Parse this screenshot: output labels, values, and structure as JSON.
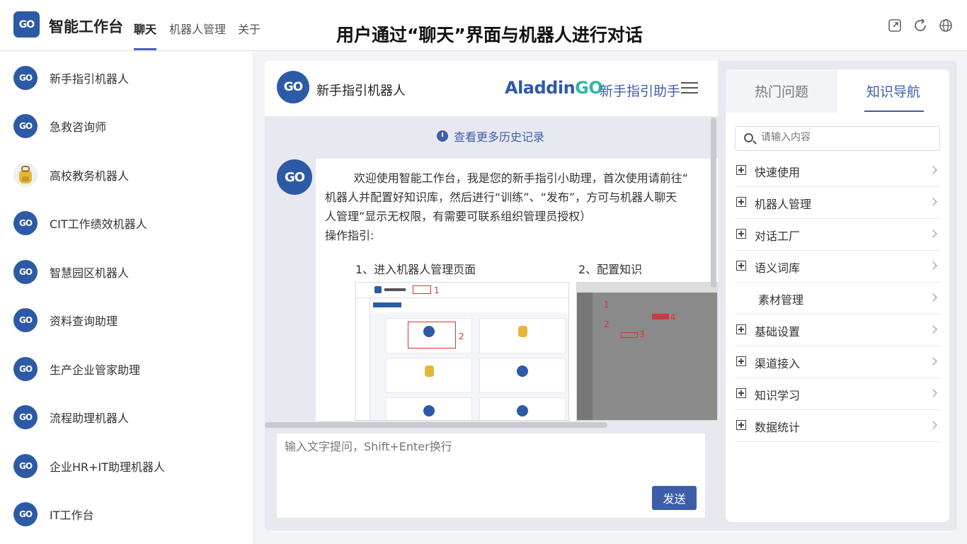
{
  "app": {
    "logo_text": "GO",
    "title": "智能工作台",
    "nav": [
      "聊天",
      "机器人管理",
      "关于"
    ],
    "active_nav": "聊天",
    "caption": "用户通过“聊天”界面与机器人进行对话",
    "top_icons": [
      "external-link-icon",
      "refresh-icon",
      "globe-icon"
    ]
  },
  "sidebar": {
    "items": [
      {
        "name": "新手指引机器人",
        "icon": "go-avatar"
      },
      {
        "name": "急救咨询师",
        "icon": "go-avatar"
      },
      {
        "name": "高校教务机器人",
        "icon": "backpack-avatar"
      },
      {
        "name": "CIT工作绩效机器人",
        "icon": "go-avatar"
      },
      {
        "name": "智慧园区机器人",
        "icon": "go-avatar"
      },
      {
        "name": "资料查询助理",
        "icon": "go-avatar"
      },
      {
        "name": "生产企业管家助理",
        "icon": "go-avatar"
      },
      {
        "name": "流程助理机器人",
        "icon": "go-avatar"
      },
      {
        "name": "企业HR+IT助理机器人",
        "icon": "go-avatar"
      },
      {
        "name": "IT工作台",
        "icon": "go-avatar"
      }
    ]
  },
  "chat": {
    "bot_name": "新手指引机器人",
    "brand_main": "Aladdin",
    "brand_go": "GO",
    "assistant_label": "新手指引助手",
    "history_link": "查看更多历史记录",
    "message_lines": [
      "        欢迎使用智能工作台，我是您的新手指引小助理，首次使用请前往“",
      "机器人并配置好知识库，然后进行“训练”、“发布”，方可与机器人聊天",
      "人管理”显示无权限，有需要可联系组织管理员授权）",
      "操作指引:"
    ],
    "step1": "1、进入机器人管理页面",
    "step2": "2、配置知识",
    "input_placeholder": "输入文字提问，Shift+Enter换行",
    "send_label": "发送"
  },
  "knowledge": {
    "tabs": [
      "热门问题",
      "知识导航"
    ],
    "active_tab": "知识导航",
    "search_placeholder": "请输入内容",
    "items": [
      {
        "label": "快速使用",
        "expandable": true
      },
      {
        "label": "机器人管理",
        "expandable": true
      },
      {
        "label": "对话工厂",
        "expandable": true
      },
      {
        "label": "语义词库",
        "expandable": true
      },
      {
        "label": "素材管理",
        "expandable": false
      },
      {
        "label": "基础设置",
        "expandable": true
      },
      {
        "label": "渠道接入",
        "expandable": true
      },
      {
        "label": "知识学习",
        "expandable": true
      },
      {
        "label": "数据统计",
        "expandable": true
      }
    ]
  },
  "colors": {
    "accent": "#3d5ea7",
    "brand_go": "#2fb7a8",
    "avatar": "#2d5aa6"
  }
}
